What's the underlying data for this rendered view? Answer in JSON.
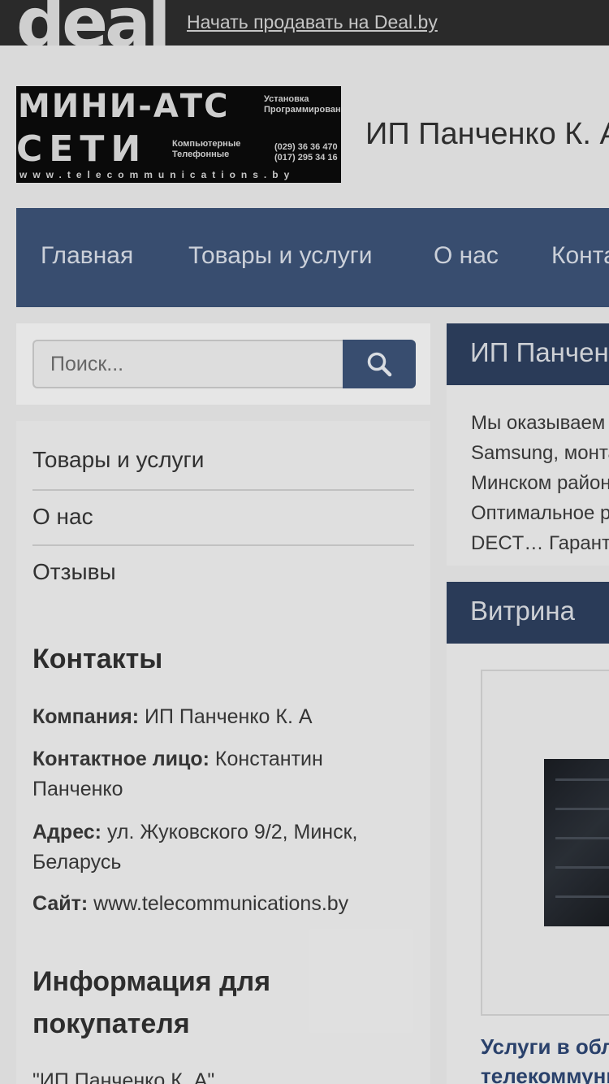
{
  "topbar": {
    "logo": "deal",
    "sell_link": "Начать продавать на Deal.by"
  },
  "brand": {
    "logo_line1": "МИНИ-АТС",
    "logo_line2": "СЕТИ",
    "logo_small1": "Установка\nПрограммирование",
    "logo_small2": "Компьютерные\nТелефонные",
    "logo_phones": "(029) 36 36 470\n(017) 295 34 16",
    "logo_url": "www.telecommunications.by",
    "shop_title": "ИП Панченко К. А"
  },
  "nav": {
    "items": [
      "Главная",
      "Товары и услуги",
      "О нас",
      "Контакты"
    ]
  },
  "search": {
    "placeholder": "Поиск...",
    "icon": "magnifier-icon"
  },
  "sidebar": {
    "menu": [
      "Товары и услуги",
      "О нас",
      "Отзывы"
    ],
    "contacts_title": "Контакты",
    "contacts": {
      "company_label": "Компания:",
      "company_value": "ИП Панченко К. А",
      "person_label": "Контактное лицо:",
      "person_value": "Константин Панченко",
      "address_label": "Адрес:",
      "address_value": "ул. Жуковского 9/2, Минск, Беларусь",
      "site_label": "Сайт:",
      "site_value": "www.telecommunications.by"
    },
    "info_title": "Информация для покупателя",
    "info_text": "\"ИП Панченко К. А\""
  },
  "about": {
    "title": "ИП Панченко К. А",
    "lines": [
      "Мы оказываем услуги по установке мини-АТС Panasonic,",
      "Samsung, монтажу компьютерных сетей в Минске и",
      "Минском районе.",
      "Оптимальное решение для офиса: мини-АТС, телефоны",
      "DECT… Гарантия качества."
    ]
  },
  "showcase": {
    "title": "Витрина",
    "product_title_line1": "Услуги в области",
    "product_title_line2": "телекоммуникаций"
  }
}
